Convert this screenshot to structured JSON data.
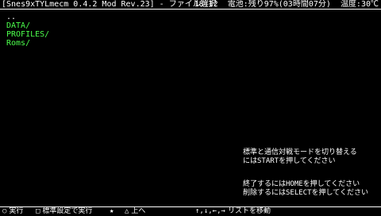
{
  "topbar": {
    "title": "[Snes9xTYLmecm 0.4.2 Mod Rev.23] - ファイル選択",
    "time": "18:12",
    "battery": "電池:残り97%(03時間07分)",
    "temperature": "温度:30℃"
  },
  "filelist": {
    "items": [
      "..",
      "DATA/",
      "PROFILES/",
      "Roms/"
    ]
  },
  "help": {
    "line1": "標準と通信対戦モードを切り替える",
    "line2": "にはSTARTを押してください",
    "line3": "終了するにはHOMEを押してください",
    "line4": "削除するにはSELECTを押してください"
  },
  "bottombar": {
    "circle": "○",
    "circle_label": "実行",
    "square": "□",
    "square_label": "標準設定で実行",
    "star": "★",
    "triangle": "△",
    "triangle_label": "上へ",
    "arrows": "↑,↓,←,→",
    "arrows_label": "リストを移動"
  }
}
